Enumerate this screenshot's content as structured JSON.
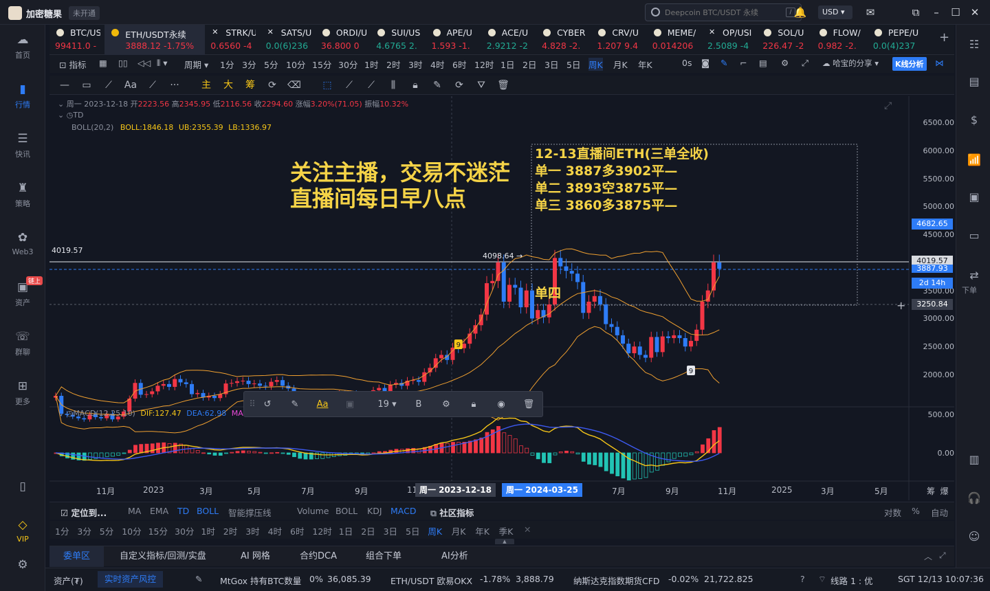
{
  "app": {
    "brand": "加密糖果",
    "status_badge": "未开通"
  },
  "search": {
    "placeholder": "Deepcoin BTC/USDT 永续",
    "shortcut": "/"
  },
  "currency": "USD",
  "sidebar": [
    {
      "label": "首页",
      "icon": "home-icon"
    },
    {
      "label": "行情",
      "icon": "chart-bars-icon",
      "active": true
    },
    {
      "label": "快讯",
      "icon": "news-icon"
    },
    {
      "label": "策略",
      "icon": "strategy-icon"
    },
    {
      "label": "Web3",
      "icon": "web3-icon"
    },
    {
      "label": "资产",
      "icon": "wallet-icon",
      "tag": "链上"
    },
    {
      "label": "群聊",
      "icon": "chat-icon"
    },
    {
      "label": "更多",
      "icon": "grid-icon"
    }
  ],
  "sidebar_bottom": {
    "vip": "VIP"
  },
  "tickers": [
    {
      "sym": "BTC/US",
      "price": "99411.0 -",
      "color": "red"
    },
    {
      "sym": "ETH/USDT永续",
      "price": "3888.12  -1.75%",
      "color": "red",
      "active": true
    },
    {
      "sym": "STRK/U",
      "price": "0.6560  -4",
      "color": "red",
      "x": true
    },
    {
      "sym": "SATS/U",
      "price": "0.0(6)236",
      "color": "green",
      "x": true
    },
    {
      "sym": "ORDI/U",
      "price": "36.800  0",
      "color": "red"
    },
    {
      "sym": "SUI/US",
      "price": "4.6765  2.",
      "color": "green"
    },
    {
      "sym": "APE/U",
      "price": "1.593  -1.",
      "color": "red"
    },
    {
      "sym": "ACE/U",
      "price": "2.9212  -2",
      "color": "green"
    },
    {
      "sym": "CYBER",
      "price": "4.828  -2.",
      "color": "red"
    },
    {
      "sym": "CRV/U",
      "price": "1.207  9.4",
      "color": "red"
    },
    {
      "sym": "MEME/",
      "price": "0.014206",
      "color": "red"
    },
    {
      "sym": "OP/USI",
      "price": "2.5089  -4",
      "color": "green",
      "x": true
    },
    {
      "sym": "SOL/U",
      "price": "226.47  -2",
      "color": "red"
    },
    {
      "sym": "FLOW/",
      "price": "0.982  -2.",
      "color": "red"
    },
    {
      "sym": "PEPE/U",
      "price": "0.0(4)237",
      "color": "green"
    }
  ],
  "toolbar1": {
    "indicator": "指标",
    "period": "周期",
    "timeframes": [
      "1分",
      "3分",
      "5分",
      "10分",
      "15分",
      "30分",
      "1时",
      "2时",
      "3时",
      "4时",
      "6时",
      "12时",
      "1日",
      "2日",
      "3日",
      "5日",
      "周K",
      "月K",
      "年K"
    ],
    "active_tf": "周K",
    "zero": "0s",
    "share": "哈宝的分享",
    "kline": "K线分析"
  },
  "toolbar2": {
    "y_labels": [
      "主",
      "大",
      "筹"
    ]
  },
  "chart_info": {
    "date_line": "周一 2023-12-18",
    "open_label": "开",
    "open": "2223.56",
    "high_label": "高",
    "high": "2345.95",
    "low_label": "低",
    "low": "2116.56",
    "close_label": "收",
    "close": "2294.60",
    "chg_label": "涨幅",
    "chg": "3.20%(71.05)",
    "amp_label": "振幅",
    "amp": "10.32%",
    "td": "TD",
    "boll_name": "BOLL(20,2)",
    "boll": "BOLL:1846.18",
    "ub": "UB:2355.39",
    "lb": "LB:1336.97",
    "macd_name": "MACD(12,25,10)",
    "dif": "DIF:127.47",
    "dea": "DEA:62.98",
    "ma": "MA"
  },
  "chart_data": {
    "type": "candlestick",
    "y_ticks": [
      "6500.00",
      "6000.00",
      "5500.00",
      "5000.00",
      "4500.00",
      "3500.00",
      "3000.00",
      "2500.00",
      "2000.00"
    ],
    "macd_ticks": [
      "500.00",
      "0.00"
    ],
    "x_ticks": [
      "11月",
      "2023",
      "3月",
      "5月",
      "7月",
      "9月",
      "11",
      "月",
      "7月",
      "9月",
      "11月",
      "2025",
      "3月",
      "5月"
    ],
    "x_highlight_1": "周一 2023-12-18",
    "x_highlight_2": "周一 2024-03-25",
    "price_tags": {
      "current": "4682.65",
      "line_4019": "4019.57",
      "line_3887": "3887.93",
      "countdown": "2d 14h",
      "cross": "3250.84"
    },
    "hline_label_left": "4019.57",
    "peak_label": "4098.64",
    "markers": [
      "9",
      "9"
    ],
    "closes": [
      1620,
      1300,
      1280,
      1250,
      1220,
      1200,
      1290,
      1240,
      1220,
      1300,
      1200,
      1250,
      1340,
      1570,
      1850,
      1640,
      1650,
      1700,
      1800,
      1830,
      1780,
      1920,
      1860,
      1830,
      1650,
      1670,
      1590,
      1620,
      1580,
      1650,
      1840,
      1850,
      1880,
      1890,
      1830,
      1840,
      1800,
      1790,
      1870,
      1900,
      1800,
      1750,
      1580,
      1560,
      1570,
      1590,
      1600,
      1570,
      1620,
      1640,
      1660,
      1620,
      1660,
      1640,
      1540,
      1630,
      1720,
      1760,
      1700,
      1820,
      1850,
      1800,
      1890,
      1900,
      1870,
      2040,
      2120,
      2290,
      2350,
      2260,
      2480,
      2470,
      2550,
      2730,
      2880,
      3070,
      3630,
      3670,
      4000,
      3300,
      3600,
      3550,
      3200,
      3500,
      3000,
      3150,
      3020,
      3250,
      4080,
      3930,
      3850,
      3800,
      3650,
      3100,
      3300,
      3400,
      3250,
      2900,
      2850,
      2700,
      2550,
      2380,
      2500,
      2350,
      2300,
      2670,
      2400,
      2680,
      2650,
      2700,
      2650,
      2500,
      2600,
      2800,
      3300,
      3500,
      4000,
      3888
    ],
    "overlay_box": {
      "title": "12-13直播间ETH(三单全收)",
      "lines": [
        "单一 3887多3902平—",
        "单二 3893空3875平—",
        "单三 3860多3875平—"
      ]
    },
    "promo": [
      "关注主播，交易不迷茫",
      "直播间每日早八点"
    ],
    "label_single4": "单四"
  },
  "floatbar": {
    "text_tool": "Aa",
    "font_size": "19",
    "bold": "B"
  },
  "indbar": {
    "locate": "定位到...",
    "main": [
      "MA",
      "EMA",
      "TD",
      "BOLL",
      "智能撑压线"
    ],
    "main_on": [
      "TD",
      "BOLL"
    ],
    "sub": [
      "Volume",
      "BOLL",
      "KDJ",
      "MACD"
    ],
    "sub_on": [
      "MACD"
    ],
    "community": "社区指标",
    "right": [
      "对数",
      "%",
      "自动"
    ]
  },
  "tfbar": [
    "1分",
    "3分",
    "5分",
    "10分",
    "15分",
    "30分",
    "1时",
    "2时",
    "3时",
    "4时",
    "6时",
    "12时",
    "1日",
    "2日",
    "3日",
    "5日",
    "周K",
    "月K",
    "年K",
    "季K"
  ],
  "tfbar_active": "周K",
  "bottom_tabs": [
    "委单区",
    "自定义指标/回测/实盘",
    "AI 网格",
    "合约DCA",
    "组合下单",
    "AI分析"
  ],
  "status": {
    "asset": "资产(₮)",
    "risk": "实时资产风控",
    "mtgox_label": "MtGox 持有BTC数量",
    "mtgox_pct": "0%",
    "mtgox_val": "36,085.39",
    "eth_label": "ETH/USDT 欧易OKX",
    "eth_pct": "-1.78%",
    "eth_val": "3,888.79",
    "nasdaq_label": "纳斯达克指数期货CFD",
    "nasdaq_pct": "-0.02%",
    "nasdaq_val": "21,722.825",
    "line": "线路 1 : 优",
    "time": "SGT 12/13 10:07:36"
  },
  "right_sidebar": {
    "order": "下单"
  }
}
